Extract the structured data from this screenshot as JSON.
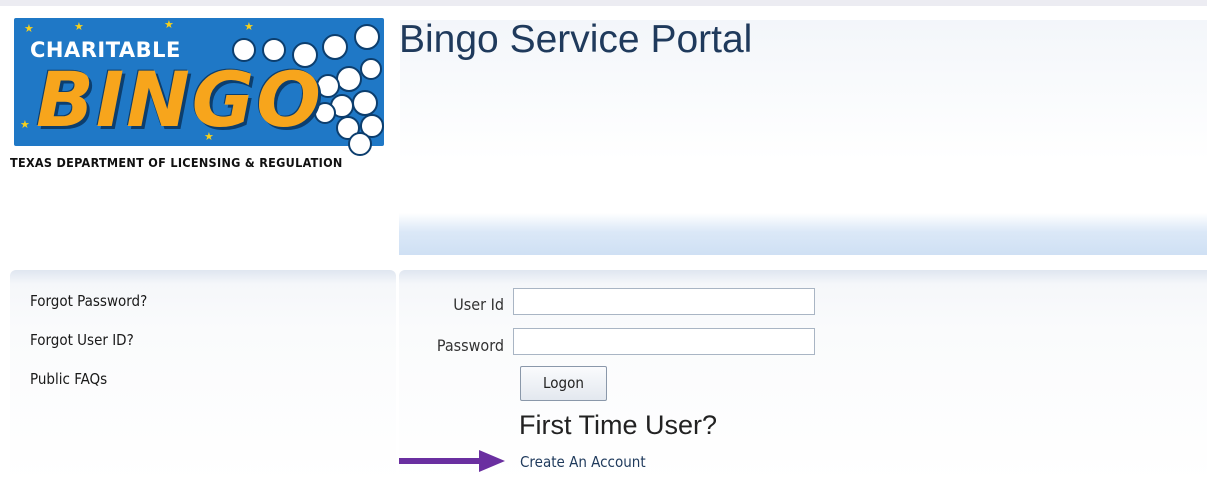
{
  "logo": {
    "top_text": "CHARITABLE",
    "main_text": "BINGO",
    "sub_text": "TEXAS DEPARTMENT OF LICENSING & REGULATION"
  },
  "header": {
    "title": "Bingo Service Portal"
  },
  "sidebar": {
    "links": [
      {
        "label": "Forgot Password?"
      },
      {
        "label": "Forgot User ID?"
      },
      {
        "label": "Public FAQs"
      }
    ]
  },
  "login": {
    "user_id_label": "User Id",
    "user_id_value": "",
    "password_label": "Password",
    "password_value": "",
    "logon_label": "Logon",
    "first_time_heading": "First Time User?",
    "create_account_label": "Create An Account"
  },
  "colors": {
    "title": "#1f3a5c",
    "logo_blue": "#1f78c6",
    "logo_orange": "#f7a51c",
    "arrow": "#6a2fa0"
  },
  "icons": {
    "annotation_arrow": "arrow-right-icon"
  }
}
